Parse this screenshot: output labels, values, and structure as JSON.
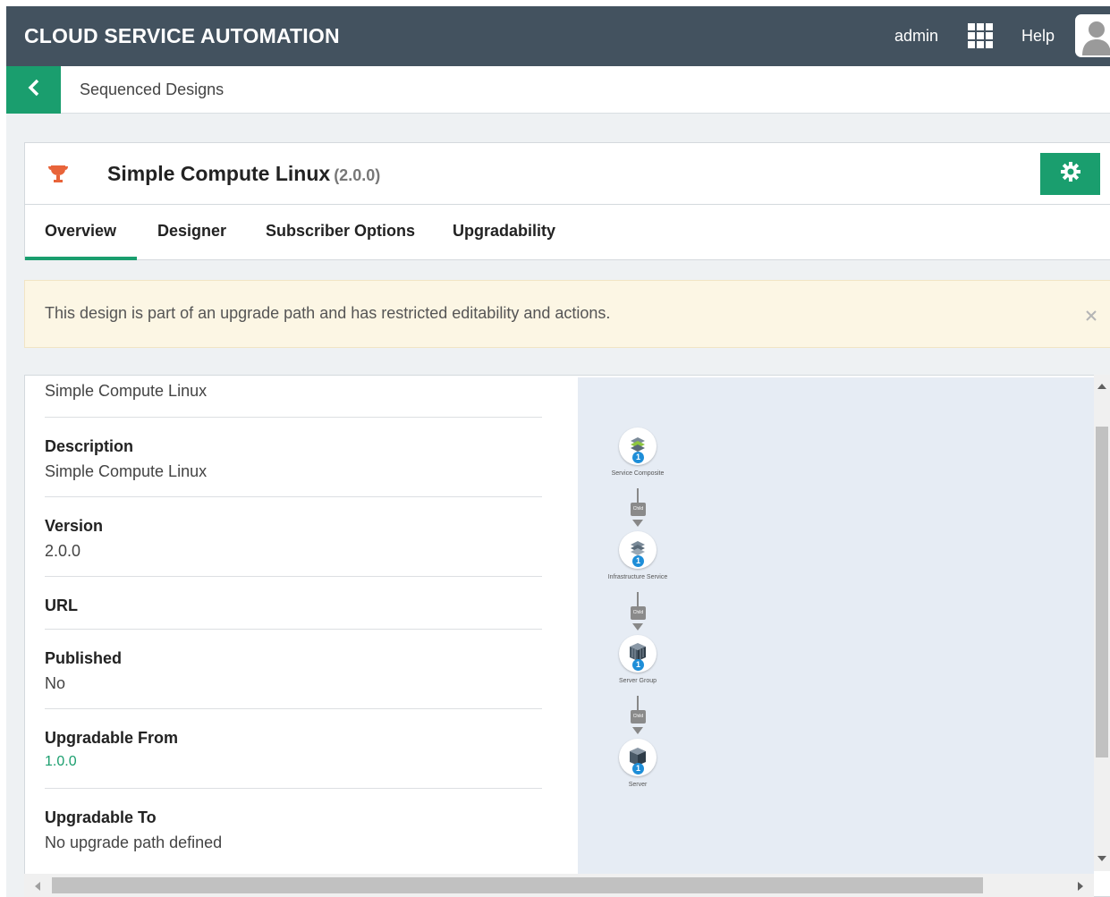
{
  "header": {
    "app_title": "CLOUD SERVICE AUTOMATION",
    "user": "admin",
    "help": "Help",
    "icons": {
      "apps": "app-grid-icon",
      "avatar": "user-avatar-icon"
    }
  },
  "breadcrumb": {
    "back_icon": "chevron-left-icon",
    "label": "Sequenced Designs"
  },
  "design": {
    "icon": "trophy-icon",
    "name": "Simple Compute Linux",
    "version": "(2.0.0)",
    "settings_icon": "gear-icon"
  },
  "tabs": [
    {
      "label": "Overview",
      "active": true
    },
    {
      "label": "Designer",
      "active": false
    },
    {
      "label": "Subscriber Options",
      "active": false
    },
    {
      "label": "Upgradability",
      "active": false
    }
  ],
  "alert": {
    "message": "This design is part of an upgrade path and has restricted editability and actions.",
    "close_icon": "close-icon"
  },
  "details": {
    "name_value": "Simple Compute Linux",
    "fields": [
      {
        "label": "Description",
        "value": "Simple Compute Linux"
      },
      {
        "label": "Version",
        "value": "2.0.0"
      },
      {
        "label": "URL",
        "value": ""
      },
      {
        "label": "Published",
        "value": "No"
      },
      {
        "label": "Upgradable From",
        "value": "1.0.0"
      },
      {
        "label": "Upgradable To",
        "value": "No upgrade path defined"
      }
    ]
  },
  "diagram": {
    "nodes": [
      {
        "label": "Service Composite",
        "count": "1"
      },
      {
        "label": "Infrastructure Service",
        "count": "1"
      },
      {
        "label": "Server Group",
        "count": "1"
      },
      {
        "label": "Server",
        "count": "1"
      }
    ],
    "relation_label": "Child"
  },
  "colors": {
    "header_bg": "#43525f",
    "accent": "#1a9e6e",
    "alert_bg": "#fcf6e4",
    "diagram_bg": "#e6ecf4"
  }
}
